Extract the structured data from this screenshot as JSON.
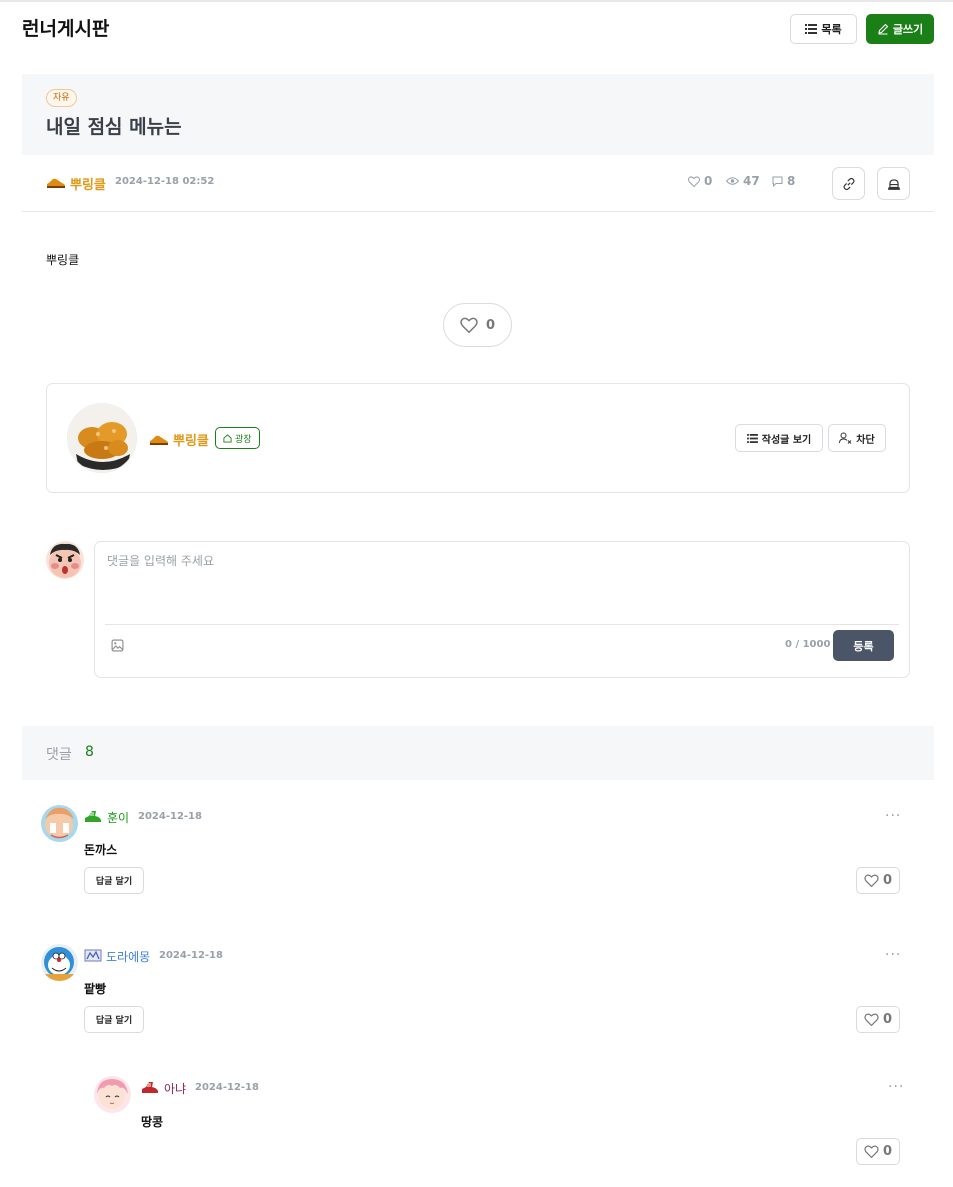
{
  "header": {
    "title": "런너게시판",
    "list_label": "목록",
    "write_label": "글쓰기"
  },
  "post": {
    "category": "자유",
    "title": "내일 점심 메뉴는",
    "author": "뿌링클",
    "date": "2024-12-18 02:52",
    "likes": "0",
    "views": "47",
    "comments": "8",
    "body": "뿌링클",
    "like_count": "0"
  },
  "profile": {
    "name": "뿌링클",
    "badge": "광장",
    "posts_label": "작성글 보기",
    "block_label": "차단"
  },
  "comment_form": {
    "placeholder": "댓글을 입력해 주세요",
    "counter": "0 / 1000",
    "submit_label": "등록"
  },
  "comments_section": {
    "label": "댓글",
    "count": "8"
  },
  "comments": [
    {
      "name": "훈이",
      "date": "2024-12-18",
      "text": "돈까스",
      "reply_label": "답글 달기",
      "likes": "0",
      "name_color": "#1a9a16"
    },
    {
      "name": "도라에몽",
      "date": "2024-12-18",
      "text": "팥빵",
      "reply_label": "답글 달기",
      "likes": "0",
      "name_color": "#3f7fd8"
    },
    {
      "name": "아냐",
      "date": "2024-12-18",
      "text": "땅콩",
      "likes": "0",
      "name_color": "#8a2a5a"
    }
  ],
  "colors": {
    "accent_green": "#1a7f16",
    "author_orange": "#e09a1b",
    "submit_gray": "#4a5568"
  }
}
